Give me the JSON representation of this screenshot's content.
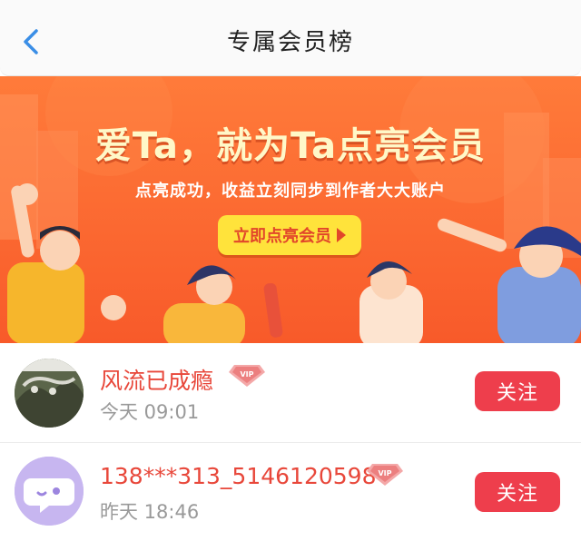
{
  "header": {
    "title": "专属会员榜"
  },
  "banner": {
    "headline": "爱Ta，就为Ta点亮会员",
    "subtitle": "点亮成功，收益立刻同步到作者大大账户",
    "cta_label": "立即点亮会员"
  },
  "members": [
    {
      "name": "风流已成瘾",
      "time": "今天 09:01",
      "follow_label": "关注"
    },
    {
      "name": "138***313_5146120598",
      "time": "昨天 18:46",
      "follow_label": "关注"
    }
  ],
  "vip_badge": "VIP",
  "colors": {
    "accent_blue": "#3a8ee6",
    "banner_orange": "#f8642e",
    "name_red": "#e8473a",
    "follow_button": "#ee3e4c",
    "cta_yellow": "#ffe33b",
    "avatar_lilac": "#c7b6f0"
  }
}
